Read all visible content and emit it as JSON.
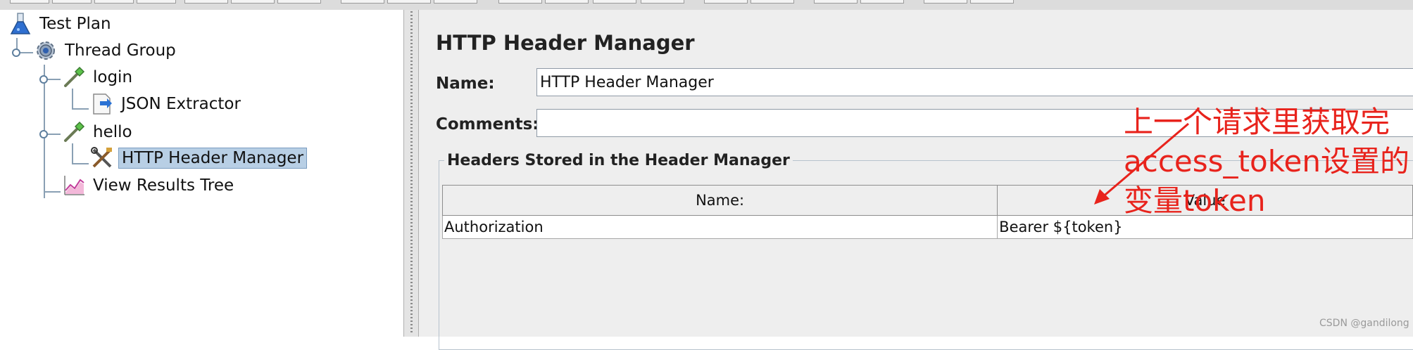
{
  "tree": {
    "items": [
      {
        "label": "Test Plan",
        "icon": "flask-icon"
      },
      {
        "label": "Thread Group",
        "icon": "gear-icon"
      },
      {
        "label": "login",
        "icon": "pipette-icon"
      },
      {
        "label": "JSON Extractor",
        "icon": "extractor-icon"
      },
      {
        "label": "hello",
        "icon": "pipette-icon"
      },
      {
        "label": "HTTP Header Manager",
        "icon": "tools-icon",
        "selected": true
      },
      {
        "label": "View Results Tree",
        "icon": "graph-icon"
      }
    ]
  },
  "panel": {
    "title": "HTTP Header Manager",
    "name_label": "Name:",
    "name_value": "HTTP Header Manager",
    "comments_label": "Comments:",
    "comments_value": "",
    "section_title": "Headers Stored in the Header Manager",
    "table": {
      "columns": [
        "Name:",
        "Value"
      ],
      "rows": [
        [
          "Authorization",
          "Bearer ${token}"
        ]
      ]
    }
  },
  "annotation": {
    "lines": [
      "上一个请求里获取完",
      "access_token设置的",
      "变量token"
    ],
    "color": "#e8231c"
  },
  "watermark": "CSDN @gandilong"
}
